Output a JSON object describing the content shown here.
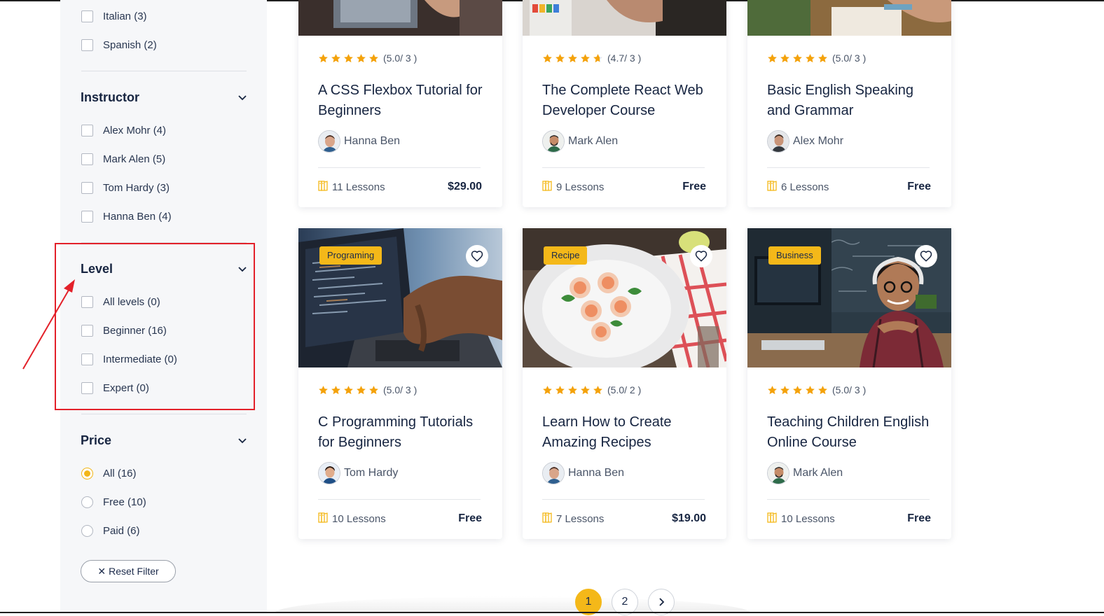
{
  "sidebar": {
    "language": {
      "items": [
        {
          "label": "Italian (3)"
        },
        {
          "label": "Spanish (2)"
        }
      ]
    },
    "instructor": {
      "title": "Instructor",
      "items": [
        {
          "label": "Alex Mohr (4)"
        },
        {
          "label": "Mark Alen (5)"
        },
        {
          "label": "Tom Hardy (3)"
        },
        {
          "label": "Hanna Ben (4)"
        }
      ]
    },
    "level": {
      "title": "Level",
      "items": [
        {
          "label": "All levels (0)"
        },
        {
          "label": "Beginner (16)"
        },
        {
          "label": "Intermediate (0)"
        },
        {
          "label": "Expert (0)"
        }
      ]
    },
    "price": {
      "title": "Price",
      "items": [
        {
          "label": "All (16)",
          "selected": true
        },
        {
          "label": "Free (10)",
          "selected": false
        },
        {
          "label": "Paid (6)",
          "selected": false
        }
      ]
    },
    "reset_label": "Reset Filter",
    "reset_icon": "close-icon"
  },
  "courses": [
    {
      "title": "A CSS Flexbox Tutorial for Beginners",
      "rating": "(5.0/ 3 )",
      "stars": 5.0,
      "instructor": "Hanna Ben",
      "lessons": "11 Lessons",
      "price": "$29.00"
    },
    {
      "title": "The Complete React Web Developer Course",
      "rating": "(4.7/ 3 )",
      "stars": 4.7,
      "instructor": "Mark Alen",
      "lessons": "9 Lessons",
      "price": "Free"
    },
    {
      "title": "Basic English Speaking and Grammar",
      "rating": "(5.0/ 3 )",
      "stars": 5.0,
      "instructor": "Alex Mohr",
      "lessons": "6 Lessons",
      "price": "Free"
    },
    {
      "title": "C Programming Tutorials for Beginners",
      "badge": "Programing",
      "rating": "(5.0/ 3 )",
      "stars": 5.0,
      "instructor": "Tom Hardy",
      "lessons": "10 Lessons",
      "price": "Free"
    },
    {
      "title": "Learn How to Create Amazing Recipes",
      "badge": "Recipe",
      "rating": "(5.0/ 2 )",
      "stars": 5.0,
      "instructor": "Hanna Ben",
      "lessons": "7 Lessons",
      "price": "$19.00"
    },
    {
      "title": "Teaching Children English Online Course",
      "badge": "Business",
      "rating": "(5.0/ 3 )",
      "stars": 5.0,
      "instructor": "Mark Alen",
      "lessons": "10 Lessons",
      "price": "Free"
    }
  ],
  "pagination": {
    "pages": [
      "1",
      "2"
    ],
    "current": "1",
    "next_icon": "chevron-right-icon"
  },
  "colors": {
    "accent": "#f4b819",
    "heading": "#172541",
    "annotation": "#e3212a",
    "sidebar_bg": "#f6f7f9"
  }
}
